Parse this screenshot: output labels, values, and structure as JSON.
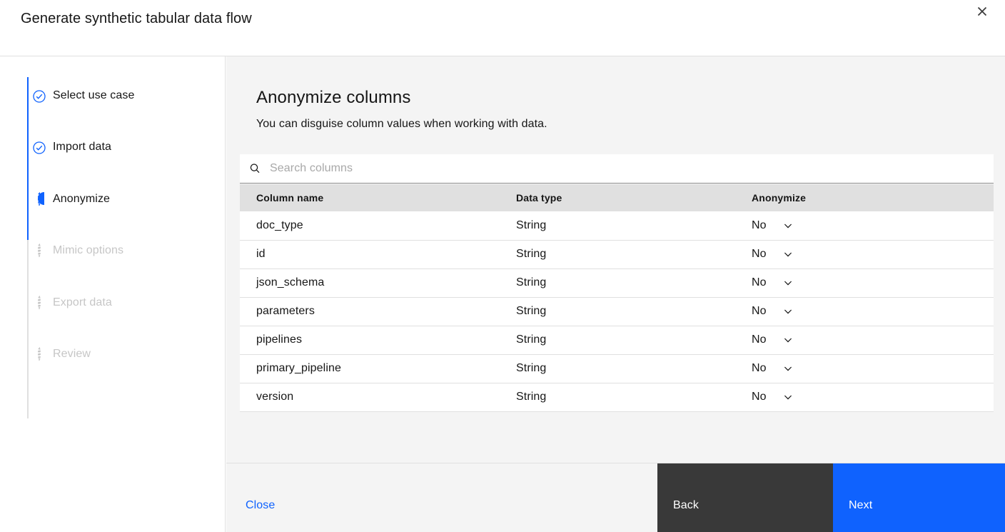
{
  "window": {
    "title": "Generate synthetic tabular data flow",
    "close_icon": "close-icon"
  },
  "sidebar": {
    "steps": [
      {
        "label": "Select use case",
        "state": "complete",
        "icon": "check-circle-icon"
      },
      {
        "label": "Import data",
        "state": "complete",
        "icon": "check-circle-icon"
      },
      {
        "label": "Anonymize",
        "state": "current",
        "icon": "half-filled-circle-icon"
      },
      {
        "label": "Mimic options",
        "state": "incomplete",
        "icon": "dotted-circle-icon"
      },
      {
        "label": "Export data",
        "state": "incomplete",
        "icon": "dotted-circle-icon"
      },
      {
        "label": "Review",
        "state": "incomplete",
        "icon": "dotted-circle-icon"
      }
    ]
  },
  "main": {
    "heading": "Anonymize columns",
    "subheading": "You can disguise column values when working with data.",
    "search": {
      "placeholder": "Search columns",
      "value": "",
      "icon": "search-icon"
    },
    "table": {
      "headers": [
        "Column name",
        "Data type",
        "Anonymize"
      ],
      "rows": [
        {
          "column_name": "doc_type",
          "data_type": "String",
          "anonymize": "No"
        },
        {
          "column_name": "id",
          "data_type": "String",
          "anonymize": "No"
        },
        {
          "column_name": "json_schema",
          "data_type": "String",
          "anonymize": "No"
        },
        {
          "column_name": "parameters",
          "data_type": "String",
          "anonymize": "No"
        },
        {
          "column_name": "pipelines",
          "data_type": "String",
          "anonymize": "No"
        },
        {
          "column_name": "primary_pipeline",
          "data_type": "String",
          "anonymize": "No"
        },
        {
          "column_name": "version",
          "data_type": "String",
          "anonymize": "No"
        }
      ],
      "dropdown_icon": "chevron-down-icon"
    }
  },
  "footer": {
    "close_label": "Close",
    "back_label": "Back",
    "next_label": "Next"
  },
  "colors": {
    "accent_blue": "#0f62fe",
    "back_gray": "#393939",
    "panel_gray": "#f4f4f4",
    "header_gray": "#e0e0e0",
    "disabled_text": "#c6c6c6"
  }
}
